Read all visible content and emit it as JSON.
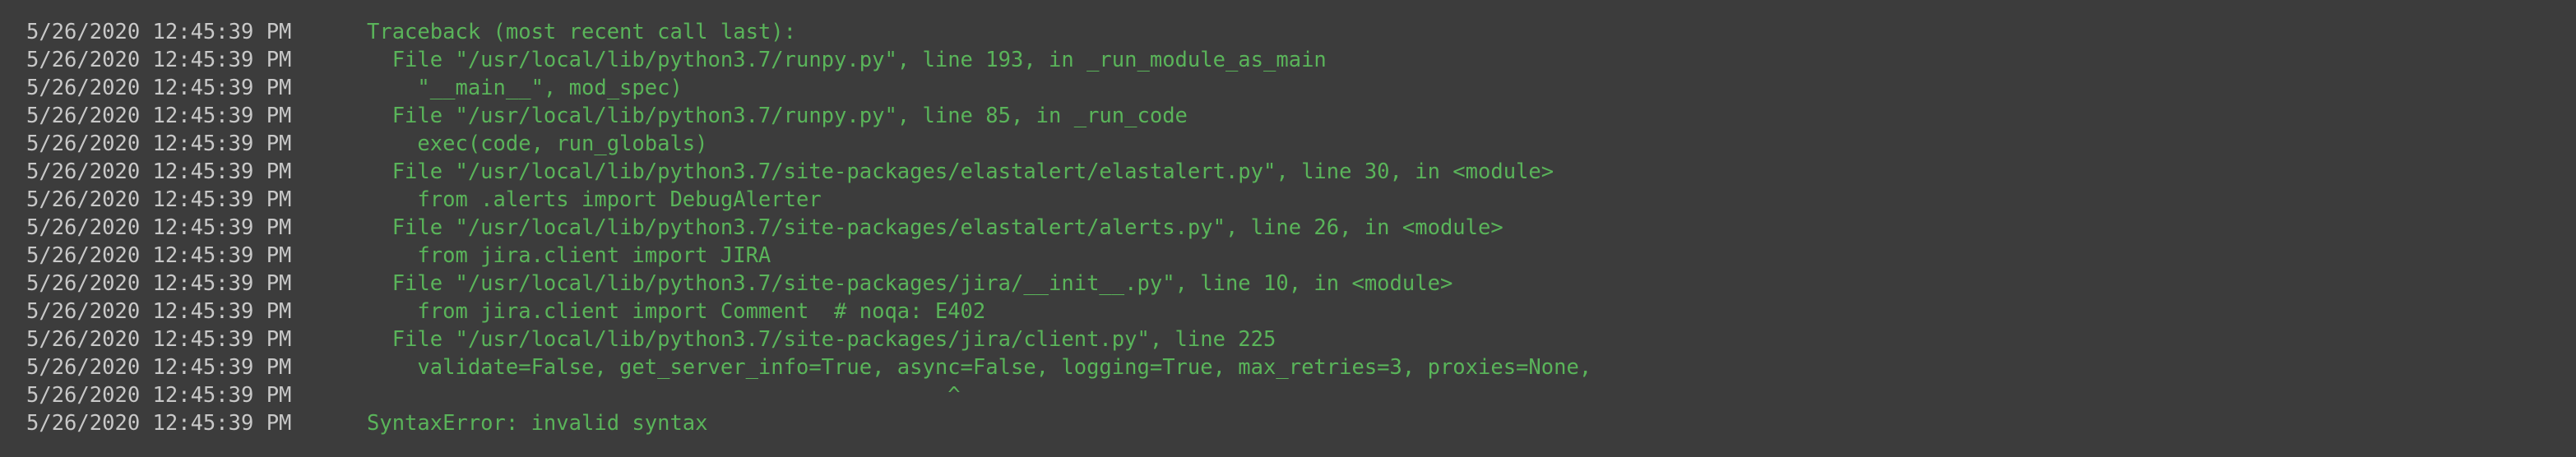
{
  "console": {
    "lines": [
      {
        "timestamp": "5/26/2020 12:45:39 PM",
        "message": "Traceback (most recent call last):"
      },
      {
        "timestamp": "5/26/2020 12:45:39 PM",
        "message": "  File \"/usr/local/lib/python3.7/runpy.py\", line 193, in _run_module_as_main"
      },
      {
        "timestamp": "5/26/2020 12:45:39 PM",
        "message": "    \"__main__\", mod_spec)"
      },
      {
        "timestamp": "5/26/2020 12:45:39 PM",
        "message": "  File \"/usr/local/lib/python3.7/runpy.py\", line 85, in _run_code"
      },
      {
        "timestamp": "5/26/2020 12:45:39 PM",
        "message": "    exec(code, run_globals)"
      },
      {
        "timestamp": "5/26/2020 12:45:39 PM",
        "message": "  File \"/usr/local/lib/python3.7/site-packages/elastalert/elastalert.py\", line 30, in <module>"
      },
      {
        "timestamp": "5/26/2020 12:45:39 PM",
        "message": "    from .alerts import DebugAlerter"
      },
      {
        "timestamp": "5/26/2020 12:45:39 PM",
        "message": "  File \"/usr/local/lib/python3.7/site-packages/elastalert/alerts.py\", line 26, in <module>"
      },
      {
        "timestamp": "5/26/2020 12:45:39 PM",
        "message": "    from jira.client import JIRA"
      },
      {
        "timestamp": "5/26/2020 12:45:39 PM",
        "message": "  File \"/usr/local/lib/python3.7/site-packages/jira/__init__.py\", line 10, in <module>"
      },
      {
        "timestamp": "5/26/2020 12:45:39 PM",
        "message": "    from jira.client import Comment  # noqa: E402"
      },
      {
        "timestamp": "5/26/2020 12:45:39 PM",
        "message": "  File \"/usr/local/lib/python3.7/site-packages/jira/client.py\", line 225"
      },
      {
        "timestamp": "5/26/2020 12:45:39 PM",
        "message": "    validate=False, get_server_info=True, async=False, logging=True, max_retries=3, proxies=None,"
      },
      {
        "timestamp": "5/26/2020 12:45:39 PM",
        "message": "                                              ^"
      },
      {
        "timestamp": "5/26/2020 12:45:39 PM",
        "message": "SyntaxError: invalid syntax"
      }
    ]
  },
  "colors": {
    "background": "#3c3c3c",
    "timestamp": "#c8c8c8",
    "message": "#5ab45a"
  }
}
